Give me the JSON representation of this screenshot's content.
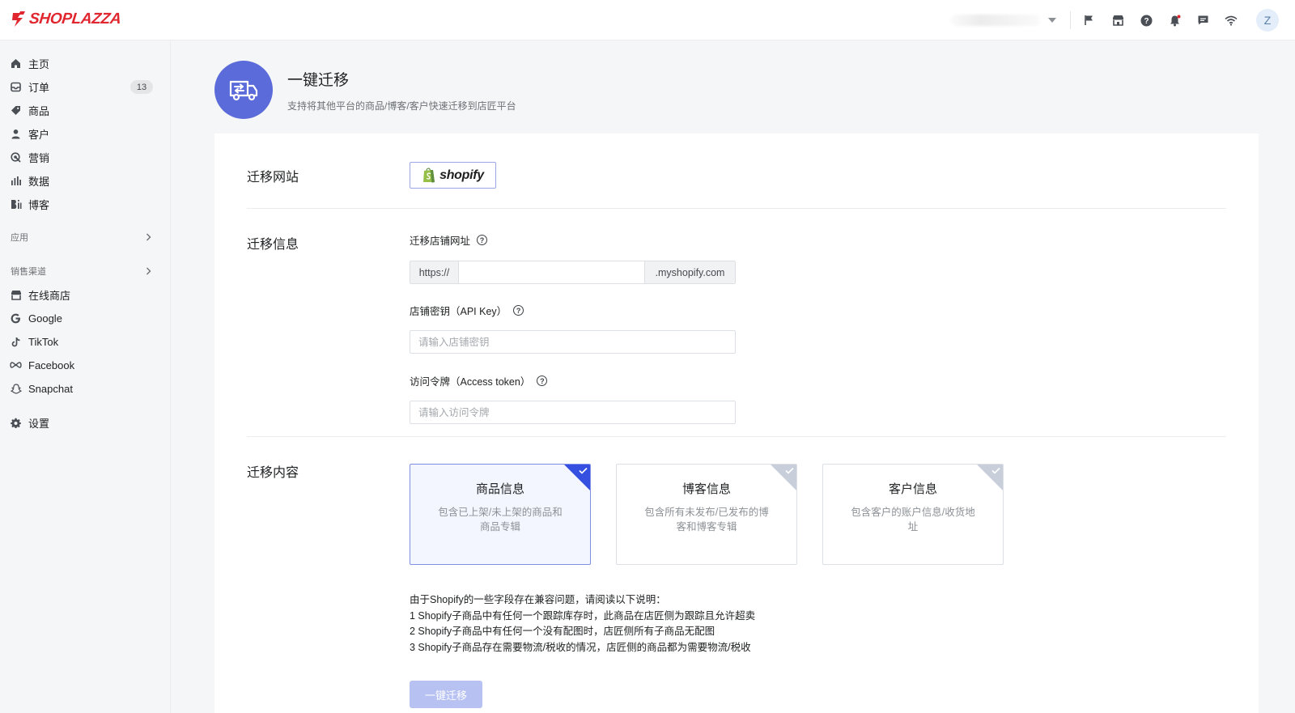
{
  "brand": {
    "name": "SHOPLAZZA",
    "color": "#e0272f"
  },
  "header": {
    "icons": [
      "flag-icon",
      "store-icon",
      "help-icon",
      "bell-icon",
      "message-icon",
      "wifi-icon"
    ],
    "avatar_letter": "Z"
  },
  "sidebar": {
    "items": [
      {
        "label": "主页",
        "icon": "home-icon"
      },
      {
        "label": "订单",
        "icon": "order-icon",
        "badge": "13"
      },
      {
        "label": "商品",
        "icon": "tag-icon"
      },
      {
        "label": "客户",
        "icon": "customer-icon"
      },
      {
        "label": "营销",
        "icon": "marketing-icon"
      },
      {
        "label": "数据",
        "icon": "analytics-icon"
      },
      {
        "label": "博客",
        "icon": "blog-icon"
      }
    ],
    "apps_heading": "应用",
    "channels_heading": "销售渠道",
    "channels": [
      {
        "label": "在线商店",
        "icon": "online-store-icon"
      },
      {
        "label": "Google",
        "icon": "google-icon"
      },
      {
        "label": "TikTok",
        "icon": "tiktok-icon"
      },
      {
        "label": "Facebook",
        "icon": "facebook-icon"
      },
      {
        "label": "Snapchat",
        "icon": "snapchat-icon"
      }
    ],
    "settings": {
      "label": "设置",
      "icon": "gear-icon"
    }
  },
  "page": {
    "title": "一键迁移",
    "subtitle": "支持将其他平台的商品/博客/客户快速迁移到店匠平台",
    "accent": "#5b6bd9"
  },
  "form": {
    "site_label": "迁移网站",
    "site_option": "shopify",
    "info_label": "迁移信息",
    "store_url_label": "迁移店铺网址",
    "url_prefix": "https://",
    "url_value": "",
    "url_suffix": ".myshopify.com",
    "api_key_label": "店铺密钥（API Key）",
    "api_key_placeholder": "请输入店铺密钥",
    "token_label": "访问令牌（Access token）",
    "token_placeholder": "请输入访问令牌",
    "content_label": "迁移内容",
    "content_options": [
      {
        "title": "商品信息",
        "desc": "包含已上架/未上架的商品和商品专辑",
        "selected": true
      },
      {
        "title": "博客信息",
        "desc": "包含所有未发布/已发布的博客和博客专辑",
        "selected": false
      },
      {
        "title": "客户信息",
        "desc": "包含客户的账户信息/收货地址",
        "selected": false
      }
    ],
    "notes": [
      "由于Shopify的一些字段存在兼容问题，请阅读以下说明：",
      "1 Shopify子商品中有任何一个跟踪库存时，此商品在店匠侧为跟踪且允许超卖",
      "2 Shopify子商品中有任何一个没有配图时，店匠侧所有子商品无配图",
      "3 Shopify子商品存在需要物流/税收的情况，店匠侧的商品都为需要物流/税收"
    ],
    "submit_label": "一键迁移"
  }
}
